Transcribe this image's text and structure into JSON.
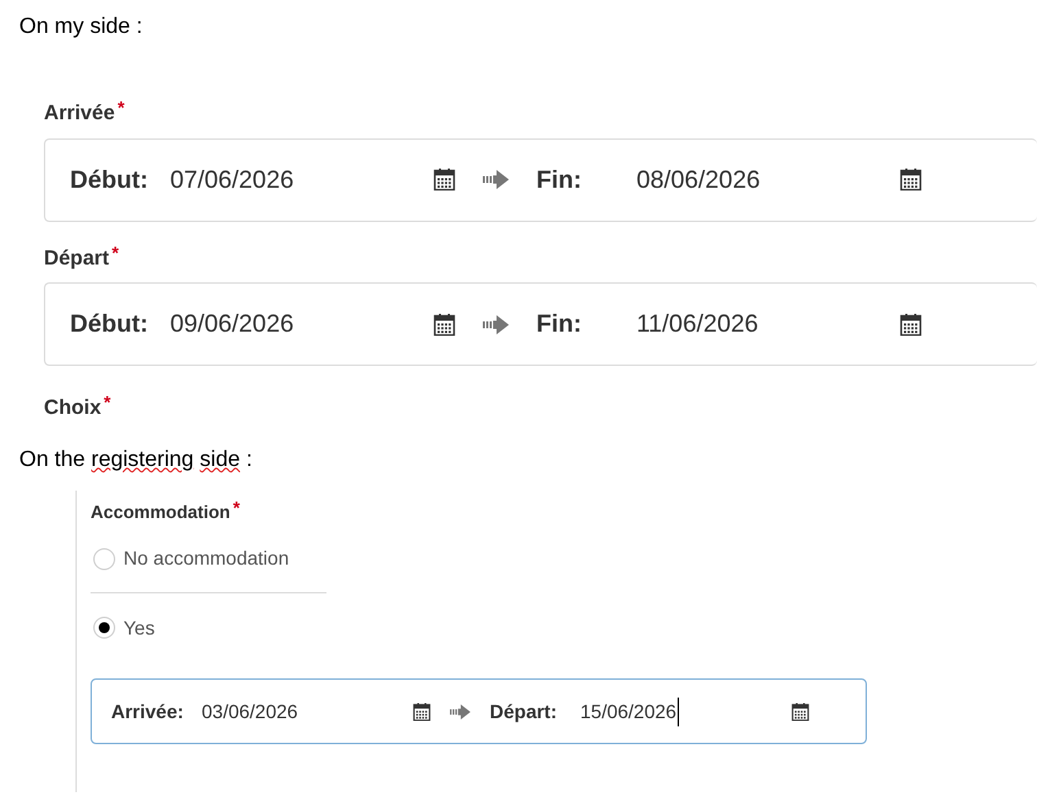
{
  "my_side": {
    "heading": "On my side :",
    "fields": [
      {
        "label": "Arrivée",
        "required_mark": "*",
        "start_label": "Début:",
        "start_value": "07/06/2026",
        "end_label": "Fin:",
        "end_value": "08/06/2026"
      },
      {
        "label": "Départ",
        "required_mark": "*",
        "start_label": "Début:",
        "start_value": "09/06/2026",
        "end_label": "Fin:",
        "end_value": "11/06/2026"
      }
    ],
    "choice": {
      "label": "Choix",
      "required_mark": "*"
    }
  },
  "registering_side": {
    "heading_parts": [
      {
        "text": "On the",
        "misspelled": false
      },
      {
        "text": "registering",
        "misspelled": true
      },
      {
        "text": "side",
        "misspelled": true
      },
      {
        "text": ":",
        "misspelled": false
      }
    ],
    "accommodation": {
      "label": "Accommodation",
      "required_mark": "*",
      "options": [
        {
          "label": "No accommodation",
          "selected": false
        },
        {
          "label": "Yes",
          "selected": true
        }
      ]
    },
    "dates": {
      "focused": true,
      "start_label": "Arrivée:",
      "start_value": "03/06/2026",
      "end_label": "Départ:",
      "end_value": "15/06/2026"
    }
  }
}
